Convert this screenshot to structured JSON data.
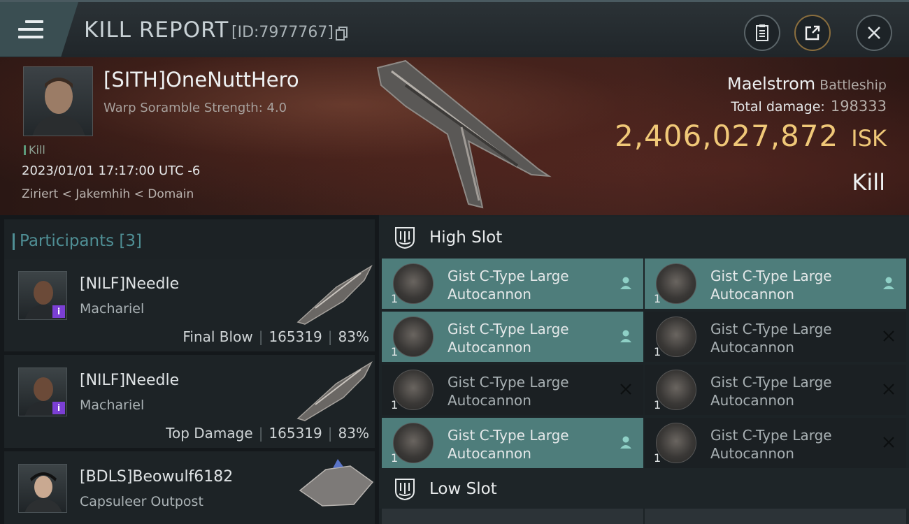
{
  "header": {
    "title": "KILL REPORT",
    "report_id": "[ID:7977767]",
    "icons": [
      "menu-icon",
      "copy-icon",
      "clipboard-icon",
      "share-icon",
      "close-icon"
    ]
  },
  "victim": {
    "pilot": "[SITH]OneNuttHero",
    "subtitle": "Warp Soramble Strength: 4.0",
    "tag": "Kill",
    "datetime": "2023/01/01 17:17:00 UTC -6",
    "location": "Ziriert < Jakemhih < Domain",
    "ship_name": "Maelstrom",
    "ship_class": "Battleship",
    "damage_label": "Total damage:",
    "damage_value": "198333",
    "isk_value": "2,406,027,872",
    "isk_unit": "ISK",
    "kill_label": "Kill"
  },
  "participants": {
    "title": "Participants",
    "count": "[3]",
    "rows": [
      {
        "name": "[NILF]Needle",
        "ship": "Machariel",
        "role": "Final Blow",
        "damage": "165319",
        "percent": "83%",
        "badge": "i"
      },
      {
        "name": "[NILF]Needle",
        "ship": "Machariel",
        "role": "Top Damage",
        "damage": "165319",
        "percent": "83%",
        "badge": "i"
      },
      {
        "name": "[BDLS]Beowulf6182",
        "ship": "Capsuleer Outpost"
      }
    ]
  },
  "slots": {
    "high_title": "High Slot",
    "low_title": "Low Slot",
    "modules": [
      {
        "name": "Gist C-Type Large Autocannon",
        "qty": "1",
        "status": "person-icon",
        "active": true
      },
      {
        "name": "Gist C-Type Large Autocannon",
        "qty": "1",
        "status": "person-icon",
        "active": true
      },
      {
        "name": "Gist C-Type Large Autocannon",
        "qty": "1",
        "status": "person-icon",
        "active": true
      },
      {
        "name": "Gist C-Type Large Autocannon",
        "qty": "1",
        "status": "x-icon",
        "active": false
      },
      {
        "name": "Gist C-Type Large Autocannon",
        "qty": "1",
        "status": "x-icon",
        "active": false
      },
      {
        "name": "Gist C-Type Large Autocannon",
        "qty": "1",
        "status": "x-icon",
        "active": false
      },
      {
        "name": "Gist C-Type Large Autocannon",
        "qty": "1",
        "status": "person-icon",
        "active": true
      },
      {
        "name": "Gist C-Type Large Autocannon",
        "qty": "1",
        "status": "x-icon",
        "active": false
      }
    ]
  },
  "colors": {
    "isk": "#f0c878",
    "accent_teal": "#4f8f95",
    "active_module": "#4e7d7b",
    "badge_purple": "#7b3fd4"
  }
}
